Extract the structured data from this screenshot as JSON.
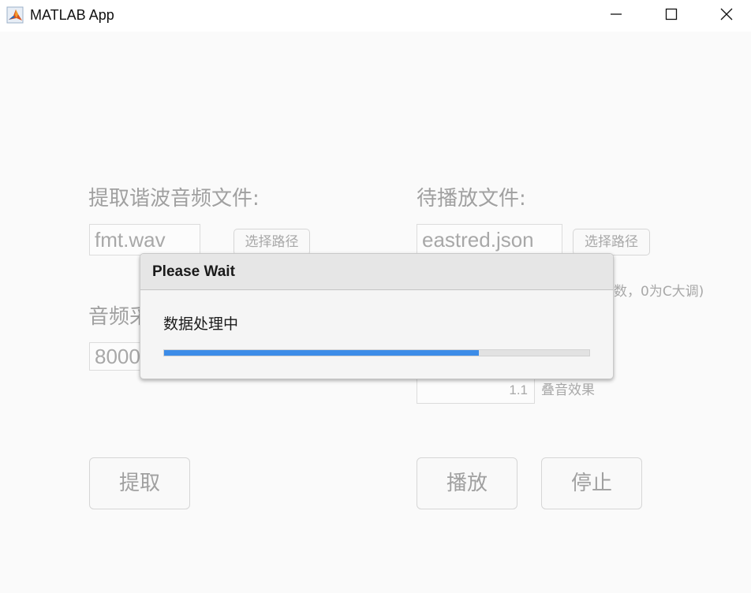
{
  "window": {
    "title": "MATLAB App"
  },
  "left_panel": {
    "extract_label": "提取谐波音频文件:",
    "extract_file_value": "fmt.wav",
    "select_path_label": "选择路径",
    "sample_rate_label": "音频采",
    "sample_rate_value": "8000",
    "extract_button_label": "提取"
  },
  "right_panel": {
    "play_file_label": "待播放文件:",
    "play_file_value": "eastred.json",
    "select_path_label": "选择路径",
    "partial_hint": "数，0为C大调)",
    "overlap_value": "1.1",
    "overlap_label": "叠音效果",
    "play_button_label": "播放",
    "stop_button_label": "停止"
  },
  "dialog": {
    "title": "Please Wait",
    "message": "数据处理中",
    "progress_fraction": 0.74,
    "accent_color": "#3c8ce8"
  },
  "icons": [
    "matlab-icon",
    "minimize-icon",
    "maximize-icon",
    "close-icon"
  ]
}
